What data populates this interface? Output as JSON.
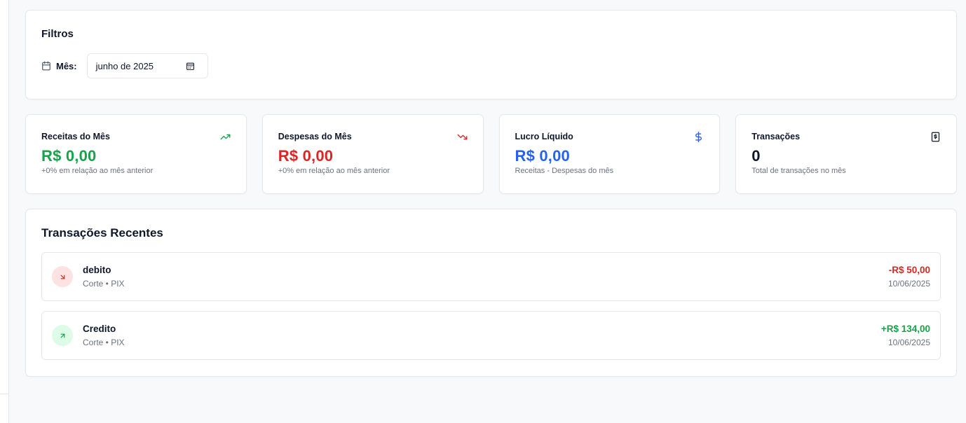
{
  "filters": {
    "title": "Filtros",
    "month_label": "Mês:",
    "month_value": "junho de 2025"
  },
  "stats": [
    {
      "title": "Receitas do Mês",
      "value": "R$ 0,00",
      "sub": "+0% em relação ao mês anterior",
      "icon": "trending-up-icon",
      "color": "#16a34a"
    },
    {
      "title": "Despesas do Mês",
      "value": "R$ 0,00",
      "sub": "+0% em relação ao mês anterior",
      "icon": "trending-down-icon",
      "color": "#dc2626"
    },
    {
      "title": "Lucro Líquido",
      "value": "R$ 0,00",
      "sub": "Receitas - Despesas do mês",
      "icon": "dollar-icon",
      "color": "#2563eb"
    },
    {
      "title": "Transações",
      "value": "0",
      "sub": "Total de transações no mês",
      "icon": "receipt-icon",
      "color": "#0f172a"
    }
  ],
  "recent": {
    "title": "Transações Recentes",
    "items": [
      {
        "name": "debito",
        "meta": "Corte • PIX",
        "amount": "-R$ 50,00",
        "date": "10/06/2025",
        "type": "expense",
        "color": "#dc2626",
        "badge_bg": "#fde2e2"
      },
      {
        "name": "Credito",
        "meta": "Corte • PIX",
        "amount": "+R$ 134,00",
        "date": "10/06/2025",
        "type": "income",
        "color": "#16a34a",
        "badge_bg": "#dcfce7"
      }
    ]
  }
}
